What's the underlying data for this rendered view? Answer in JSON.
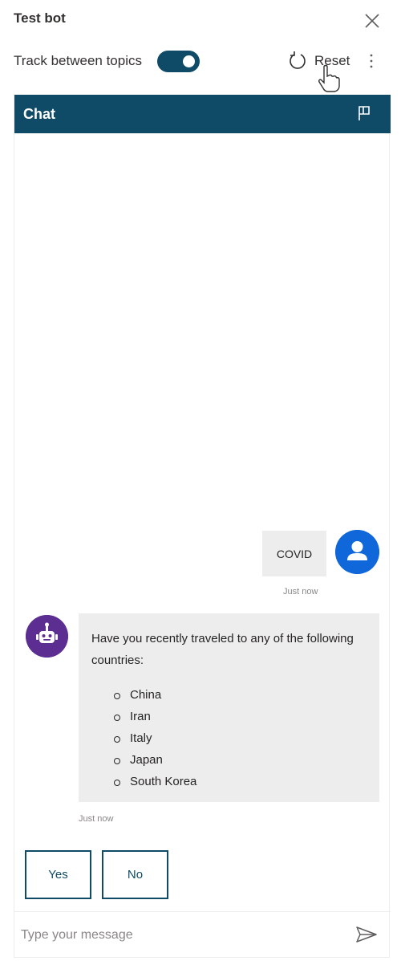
{
  "header": {
    "title": "Test bot",
    "track_label": "Track between topics",
    "track_enabled": true,
    "reset_label": "Reset"
  },
  "chat": {
    "title": "Chat",
    "messages": [
      {
        "from": "user",
        "text": "COVID",
        "timestamp": "Just now"
      },
      {
        "from": "bot",
        "text": "Have you recently traveled to any of the following countries:",
        "list": [
          "China",
          "Iran",
          "Italy",
          "Japan",
          "South Korea"
        ],
        "timestamp": "Just now"
      }
    ],
    "suggested_actions": [
      "Yes",
      "No"
    ],
    "input_placeholder": "Type your message"
  },
  "icons": {
    "close": "close-icon",
    "reset": "refresh-icon",
    "more": "more-vertical-icon",
    "flag": "flag-icon",
    "user": "user-avatar-icon",
    "bot": "bot-avatar-icon",
    "send": "send-icon"
  },
  "colors": {
    "brand": "#0f4a66",
    "user_avatar": "#0f67d9",
    "bot_avatar": "#5c2e91",
    "bubble": "#ededed"
  }
}
